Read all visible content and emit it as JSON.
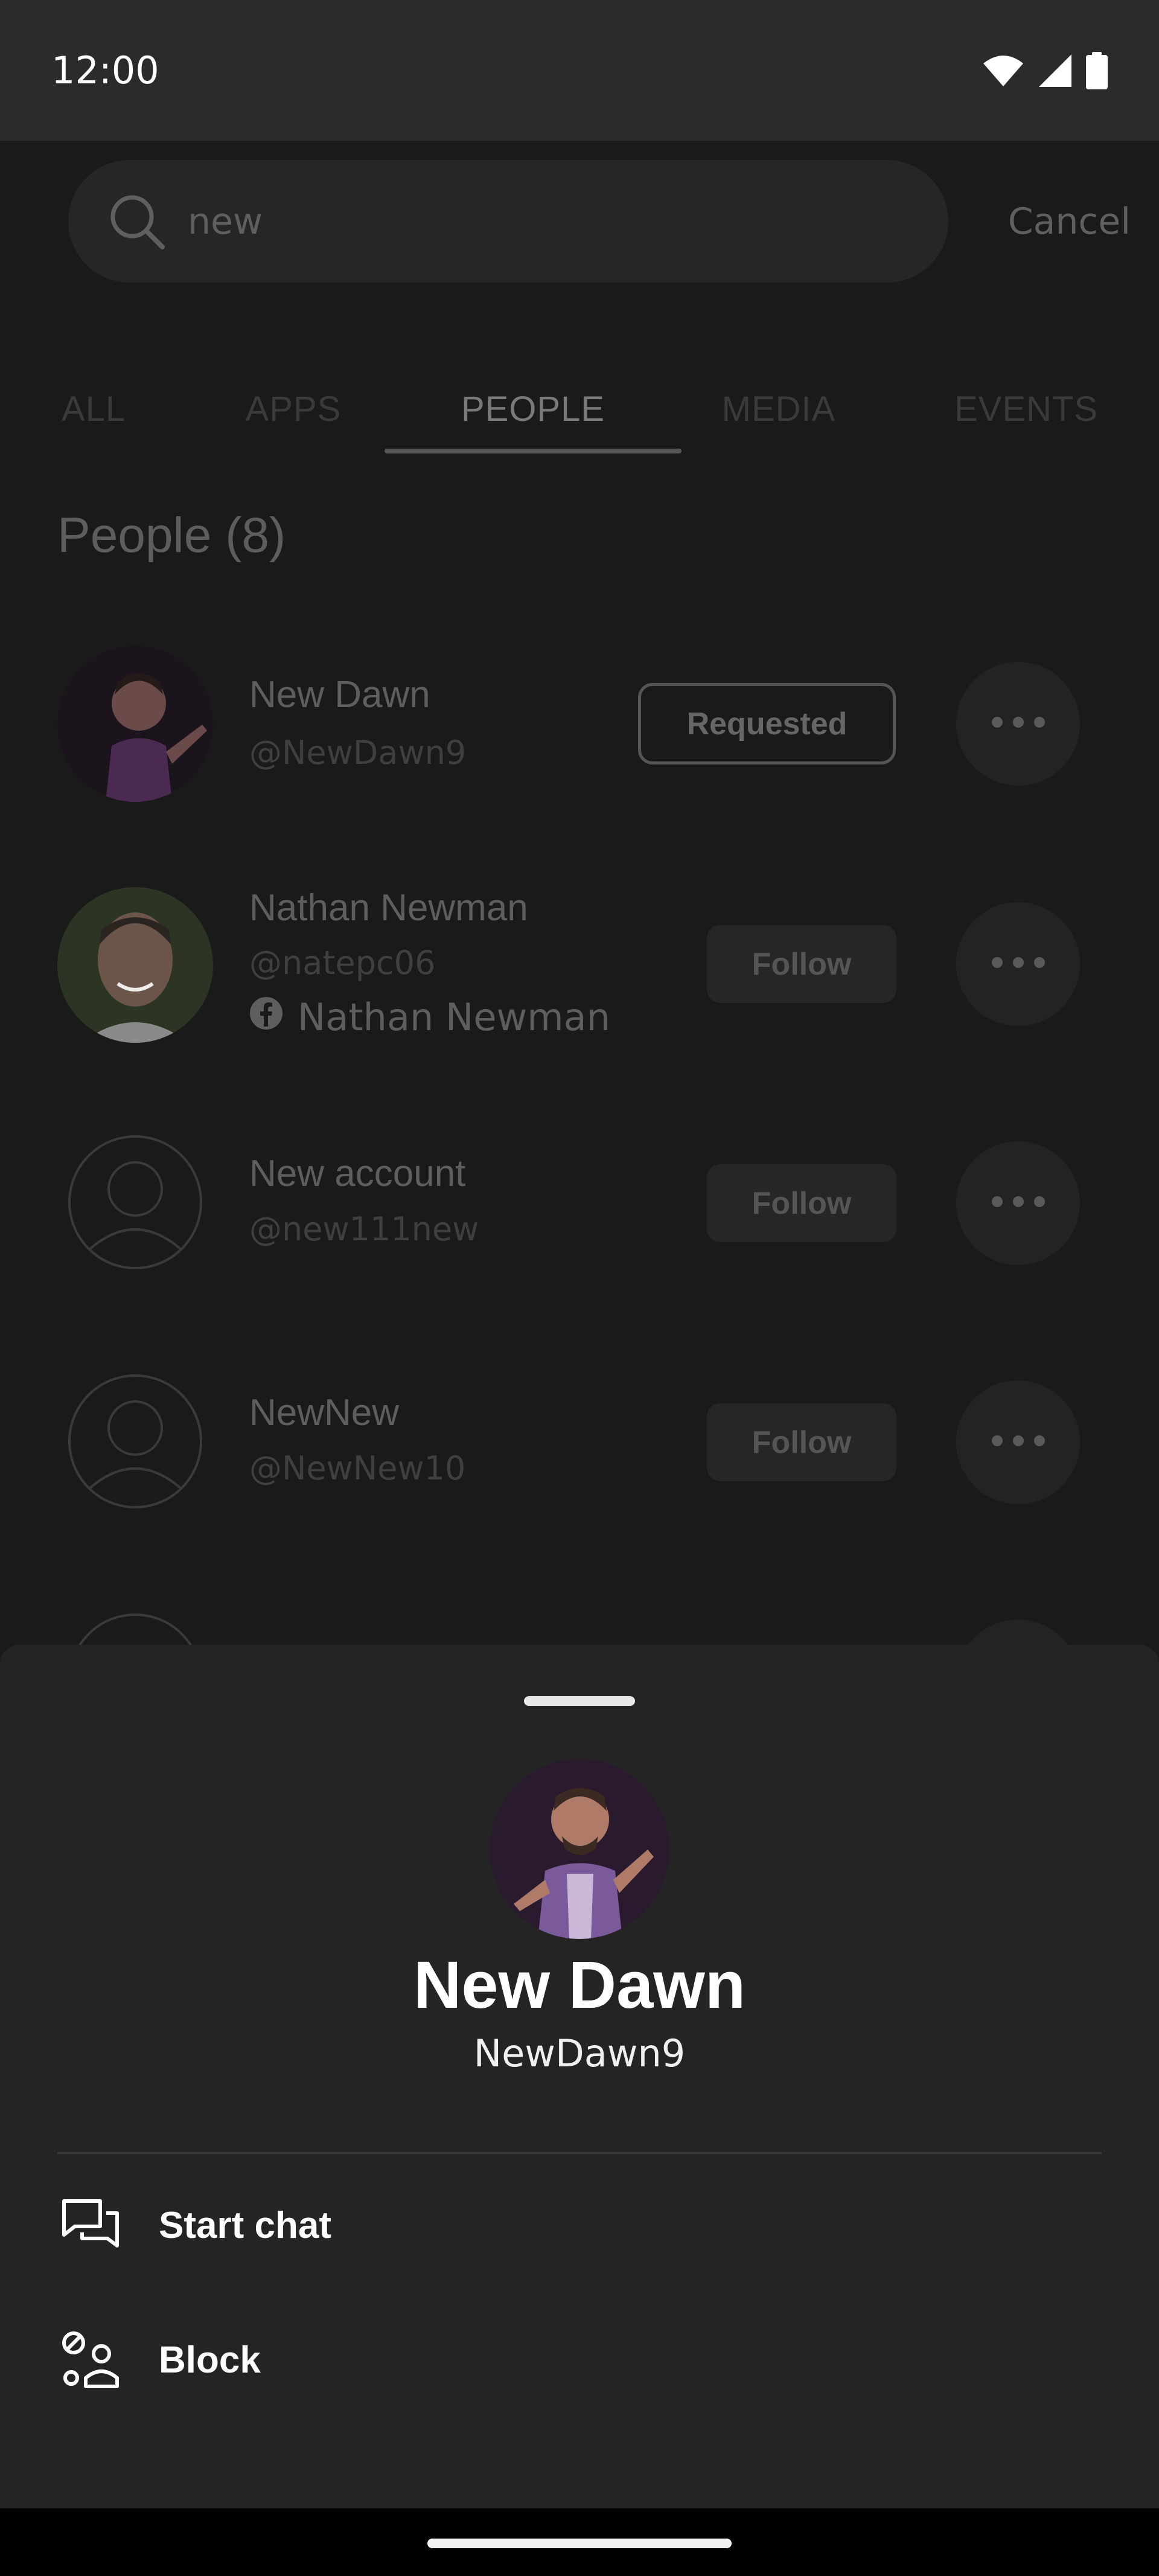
{
  "status_bar": {
    "time": "12:00",
    "icons": [
      "wifi-icon",
      "signal-icon",
      "battery-icon"
    ]
  },
  "search": {
    "query": "new",
    "cancel_label": "Cancel"
  },
  "tabs": [
    {
      "label": "ALL",
      "active": false
    },
    {
      "label": "APPS",
      "active": false
    },
    {
      "label": "PEOPLE",
      "active": true
    },
    {
      "label": "MEDIA",
      "active": false
    },
    {
      "label": "EVENTS",
      "active": false
    }
  ],
  "people": {
    "title": "People (8)",
    "items": [
      {
        "name": "New Dawn",
        "handle": "@NewDawn9",
        "action": "Requested",
        "avatar": "bitmoji-avatar"
      },
      {
        "name": "Nathan Newman",
        "handle": "@natepc06",
        "facebook_name": "Nathan Newman",
        "action": "Follow",
        "avatar": "photo-avatar"
      },
      {
        "name": "New account",
        "handle": "@new111new",
        "action": "Follow",
        "avatar": "default-avatar"
      },
      {
        "name": "NewNew",
        "handle": "@NewNew10",
        "action": "Follow",
        "avatar": "default-avatar"
      }
    ]
  },
  "sheet": {
    "name": "New Dawn",
    "handle": "NewDawn9",
    "actions": [
      {
        "label": "Start chat",
        "icon": "chat-icon"
      },
      {
        "label": "Block",
        "icon": "block-user-icon"
      }
    ]
  },
  "colors": {
    "background": "#1a1a1a",
    "sheet": "#242424",
    "text_primary": "#ffffff"
  }
}
